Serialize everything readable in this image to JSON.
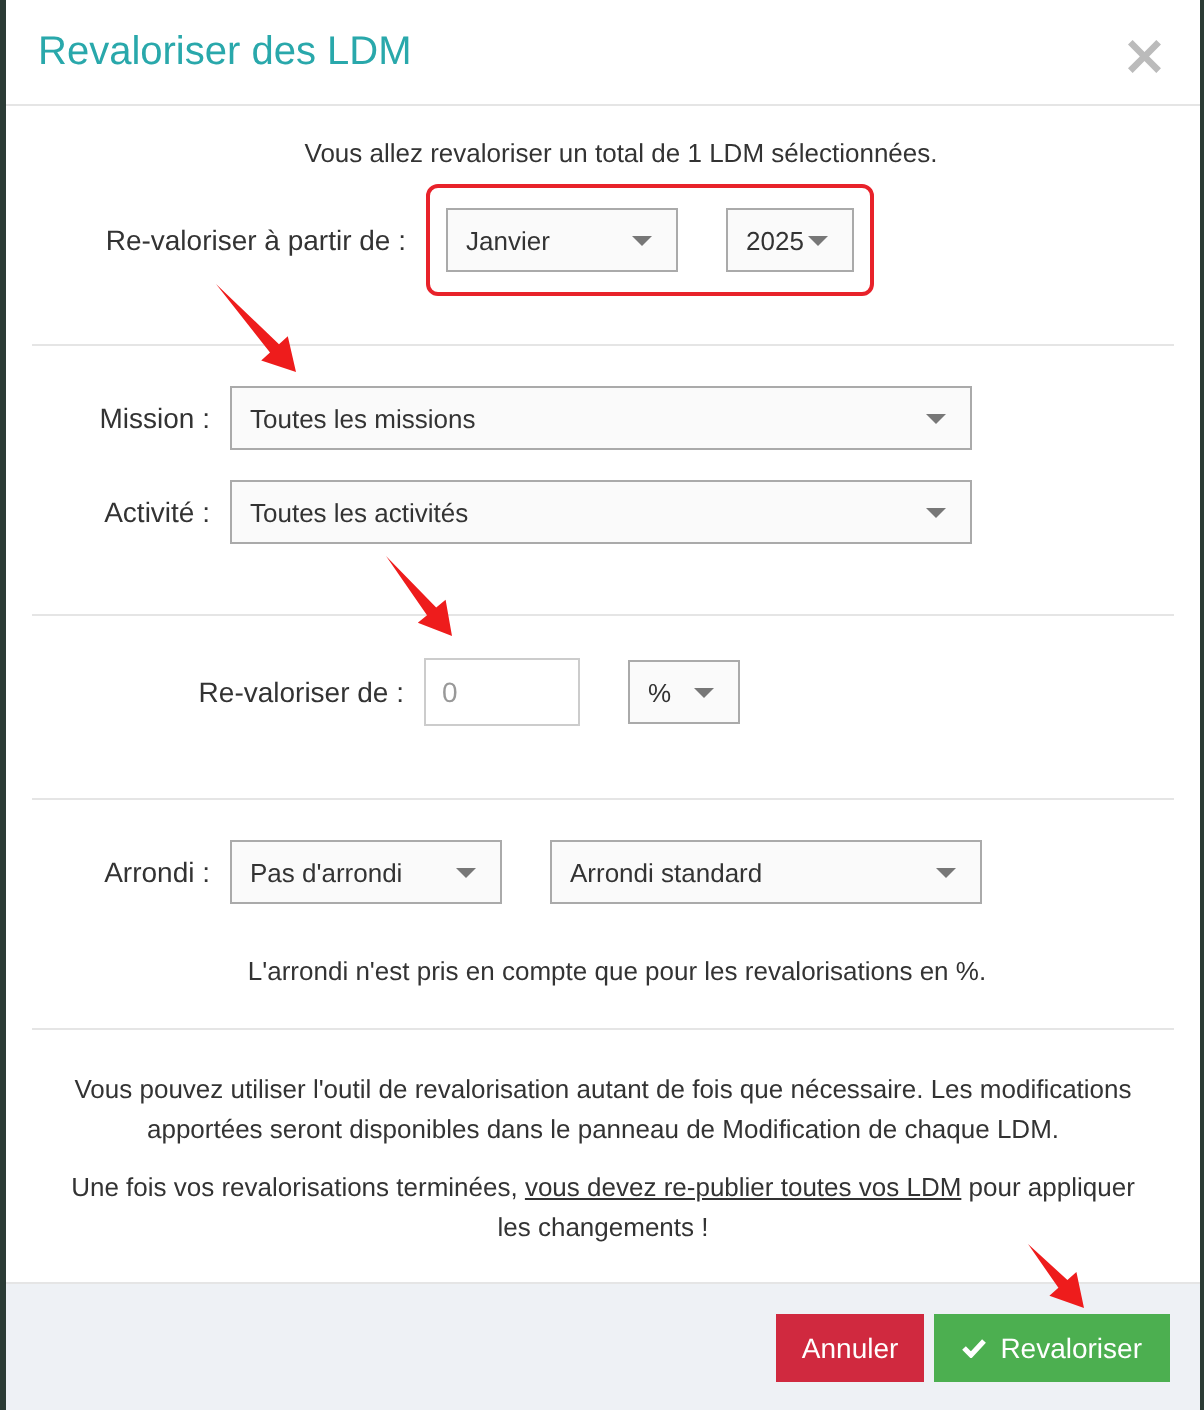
{
  "dialog": {
    "title": "Revaloriser des LDM",
    "close": "×"
  },
  "intro": "Vous allez revaloriser un total de 1 LDM sélectionnées.",
  "start": {
    "label": "Re-valoriser à partir de :",
    "month": "Janvier",
    "year": "2025"
  },
  "filters": [
    {
      "label": "Mission :",
      "value": "Toutes les missions"
    },
    {
      "label": "Activité :",
      "value": "Toutes les activités"
    }
  ],
  "amount": {
    "label": "Re-valoriser de :",
    "placeholder": "0",
    "unit": "%"
  },
  "rounding": {
    "label": "Arrondi :",
    "mode": "Pas d'arrondi",
    "method": "Arrondi standard",
    "note": "L'arrondi n'est pris en compte que pour les revalorisations en %."
  },
  "info": [
    {
      "before": "Vous pouvez utiliser l'outil de revalorisation autant de fois que nécessaire. Les modifications apportées seront disponibles dans le panneau de Modification de chaque LDM."
    },
    {
      "before": "Une fois vos revalorisations terminées, ",
      "link": "vous devez re-publier toutes vos LDM",
      "after": " pour appliquer les changements !"
    }
  ],
  "buttons": [
    {
      "label": "Annuler",
      "kind": "cancel"
    },
    {
      "label": "Revaloriser",
      "kind": "confirm"
    }
  ]
}
